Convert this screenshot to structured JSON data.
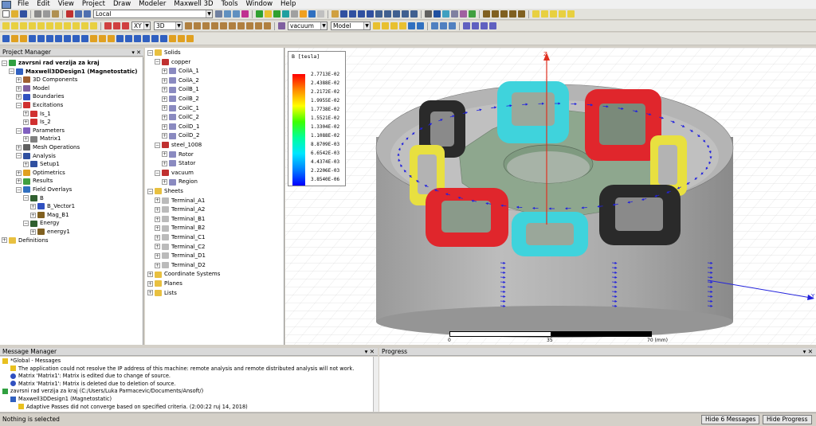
{
  "menu": [
    "File",
    "Edit",
    "View",
    "Project",
    "Draw",
    "Modeler",
    "Maxwell 3D",
    "Tools",
    "Window",
    "Help"
  ],
  "toolbar": {
    "coord_system": "Local",
    "plane": "XY",
    "dimension": "3D",
    "material": "vacuum",
    "model": "Model"
  },
  "project_manager": {
    "title": "Project Manager",
    "controls": "▾ ✕",
    "items": [
      {
        "label": "zavrsni rad verzija za kraj",
        "depth": 0,
        "bold": true,
        "icon": "project-icon"
      },
      {
        "label": "Maxwell3DDesign1 (Magnetostatic)",
        "depth": 1,
        "bold": true,
        "icon": "design-icon"
      },
      {
        "label": "3D Components",
        "depth": 2,
        "icon": "components-icon"
      },
      {
        "label": "Model",
        "depth": 2,
        "icon": "model-icon"
      },
      {
        "label": "Boundaries",
        "depth": 2,
        "icon": "boundaries-icon"
      },
      {
        "label": "Excitations",
        "depth": 2,
        "icon": "excitations-icon"
      },
      {
        "label": "Is_1",
        "depth": 3,
        "icon": "current-icon"
      },
      {
        "label": "Is_2",
        "depth": 3,
        "icon": "current-icon"
      },
      {
        "label": "Parameters",
        "depth": 2,
        "icon": "parameters-icon"
      },
      {
        "label": "Matrix1",
        "depth": 3,
        "icon": "matrix-icon"
      },
      {
        "label": "Mesh Operations",
        "depth": 2,
        "icon": "mesh-icon"
      },
      {
        "label": "Analysis",
        "depth": 2,
        "icon": "analysis-icon"
      },
      {
        "label": "Setup1",
        "depth": 3,
        "icon": "setup-icon"
      },
      {
        "label": "Optimetrics",
        "depth": 2,
        "icon": "optimetrics-icon"
      },
      {
        "label": "Results",
        "depth": 2,
        "icon": "results-icon"
      },
      {
        "label": "Field Overlays",
        "depth": 2,
        "icon": "overlay-icon"
      },
      {
        "label": "B",
        "depth": 3,
        "icon": "field-icon"
      },
      {
        "label": "B_Vector1",
        "depth": 4,
        "icon": "vector-icon"
      },
      {
        "label": "Mag_B1",
        "depth": 4,
        "icon": "plot-icon"
      },
      {
        "label": "Energy",
        "depth": 3,
        "icon": "field-icon"
      },
      {
        "label": "energy1",
        "depth": 4,
        "icon": "plot-icon"
      },
      {
        "label": "Definitions",
        "depth": 0,
        "icon": "folder-icon"
      }
    ]
  },
  "model_tree": {
    "items": [
      {
        "label": "Solids",
        "depth": 0,
        "icon": "folder-icon"
      },
      {
        "label": "copper",
        "depth": 1,
        "icon": "material-icon"
      },
      {
        "label": "CoilA_1",
        "depth": 2,
        "icon": "solid-icon"
      },
      {
        "label": "CoilA_2",
        "depth": 2,
        "icon": "solid-icon"
      },
      {
        "label": "CoilB_1",
        "depth": 2,
        "icon": "solid-icon"
      },
      {
        "label": "CoilB_2",
        "depth": 2,
        "icon": "solid-icon"
      },
      {
        "label": "CoilC_1",
        "depth": 2,
        "icon": "solid-icon"
      },
      {
        "label": "CoilC_2",
        "depth": 2,
        "icon": "solid-icon"
      },
      {
        "label": "CoilD_1",
        "depth": 2,
        "icon": "solid-icon"
      },
      {
        "label": "CoilD_2",
        "depth": 2,
        "icon": "solid-icon"
      },
      {
        "label": "steel_1008",
        "depth": 1,
        "icon": "material-icon"
      },
      {
        "label": "Rotor",
        "depth": 2,
        "icon": "solid-icon"
      },
      {
        "label": "Stator",
        "depth": 2,
        "icon": "solid-icon"
      },
      {
        "label": "vacuum",
        "depth": 1,
        "icon": "material-icon"
      },
      {
        "label": "Region",
        "depth": 2,
        "icon": "solid-icon"
      },
      {
        "label": "Sheets",
        "depth": 0,
        "icon": "folder-icon"
      },
      {
        "label": "Terminal_A1",
        "depth": 1,
        "icon": "sheet-icon"
      },
      {
        "label": "Terminal_A2",
        "depth": 1,
        "icon": "sheet-icon"
      },
      {
        "label": "Terminal_B1",
        "depth": 1,
        "icon": "sheet-icon"
      },
      {
        "label": "Terminal_B2",
        "depth": 1,
        "icon": "sheet-icon"
      },
      {
        "label": "Terminal_C1",
        "depth": 1,
        "icon": "sheet-icon"
      },
      {
        "label": "Terminal_C2",
        "depth": 1,
        "icon": "sheet-icon"
      },
      {
        "label": "Terminal_D1",
        "depth": 1,
        "icon": "sheet-icon"
      },
      {
        "label": "Terminal_D2",
        "depth": 1,
        "icon": "sheet-icon"
      },
      {
        "label": "Coordinate Systems",
        "depth": 0,
        "icon": "folder-icon"
      },
      {
        "label": "Planes",
        "depth": 0,
        "icon": "folder-icon"
      },
      {
        "label": "Lists",
        "depth": 0,
        "icon": "folder-icon"
      }
    ]
  },
  "legend": {
    "title": "B [tesla]",
    "values": [
      "2.7713E-02",
      "2.4388E-02",
      "2.2172E-02",
      "1.9955E-02",
      "1.7738E-02",
      "1.5521E-02",
      "1.3304E-02",
      "1.1088E-02",
      "8.8709E-03",
      "6.6542E-03",
      "4.4374E-03",
      "2.2206E-03",
      "3.8540E-06"
    ]
  },
  "viewport": {
    "axis_z": "Z",
    "axis_y": "Y",
    "scale_labels": [
      "0",
      "35",
      "70 (mm)"
    ]
  },
  "message_manager": {
    "title": "Message Manager",
    "controls": "▾ ✕",
    "lines": [
      {
        "text": "*Global - Messages",
        "depth": 0,
        "icon": "warning-icon"
      },
      {
        "text": "The application could not resolve the IP address of this machine: remote analysis and remote distributed analysis will not work.",
        "depth": 1,
        "icon": "warning-icon"
      },
      {
        "text": "Matrix 'Matrix1': Matrix is edited due to change of source.",
        "depth": 1,
        "icon": "info-icon"
      },
      {
        "text": "Matrix 'Matrix1': Matrix is deleted due to deletion of source.",
        "depth": 1,
        "icon": "info-icon"
      },
      {
        "text": "zavrsni rad verzija za kraj (C:/Users/Luka Parmacevic/Documents/Ansoft/)",
        "depth": 0,
        "icon": "project-icon"
      },
      {
        "text": "Maxwell3DDesign1 (Magnetostatic)",
        "depth": 1,
        "icon": "design-icon"
      },
      {
        "text": "Adaptive Passes did not converge based on specified criteria. (2:00:22  ruj 14, 2018)",
        "depth": 2,
        "icon": "warning-icon"
      }
    ]
  },
  "progress": {
    "title": "Progress",
    "controls": "▾ ✕"
  },
  "status": {
    "text": "Nothing is selected",
    "hide_messages": "Hide 6 Messages",
    "hide_progress": "Hide Progress"
  },
  "colors": {
    "coil_cyan": "#3fd3dc",
    "coil_red": "#e0262c",
    "coil_yellow": "#e8e040",
    "coil_black": "#2a2a2a",
    "steel": "#a8a8a8",
    "rotor": "#8ea78e",
    "axis": "#e03020",
    "vector": "#2222dd"
  }
}
